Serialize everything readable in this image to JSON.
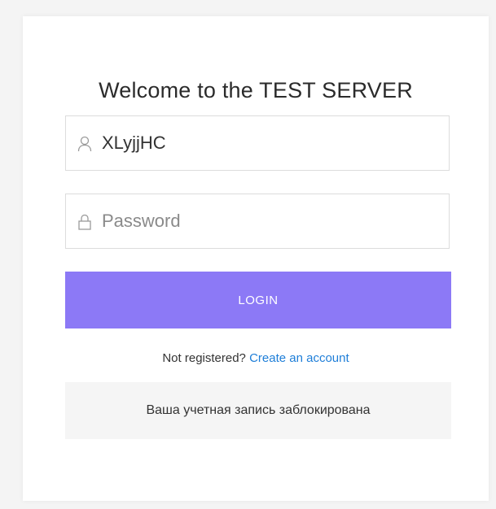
{
  "login": {
    "title": "Welcome to the TEST SERVER",
    "username": {
      "value": "XLyjjHC",
      "icon": "user-icon"
    },
    "password": {
      "value": "",
      "placeholder": "Password",
      "icon": "lock-icon"
    },
    "login_button_label": "LOGIN",
    "register_prompt": "Not registered?",
    "register_link": "Create an account",
    "status_message": "Ваша учетная запись заблокирована"
  },
  "colors": {
    "accent": "#8c79f6",
    "link": "#1e7ed8",
    "background": "#f4f4f4",
    "card": "#ffffff"
  }
}
